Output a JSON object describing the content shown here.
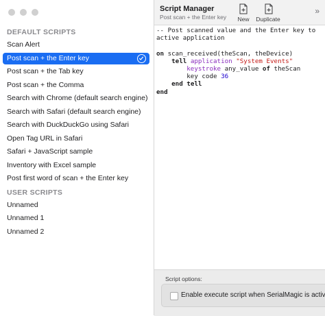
{
  "sidebar": {
    "default_header": "DEFAULT SCRIPTS",
    "user_header": "USER SCRIPTS",
    "default_items": [
      {
        "label": "Scan Alert"
      },
      {
        "label": "Post scan + the Enter key"
      },
      {
        "label": "Post scan + the Tab key"
      },
      {
        "label": "Post scan + the Comma"
      },
      {
        "label": "Search with Chrome (default search engine)"
      },
      {
        "label": "Search with Safari (default search engine)"
      },
      {
        "label": "Search with DuckDuckGo using Safari"
      },
      {
        "label": "Open Tag URL in Safari"
      },
      {
        "label": "Safari + JavaScript sample"
      },
      {
        "label": "Inventory with Excel sample"
      },
      {
        "label": "Post first word of scan + the Enter key"
      }
    ],
    "user_items": [
      {
        "label": "Unnamed"
      },
      {
        "label": "Unnamed 1"
      },
      {
        "label": "Unnamed 2"
      }
    ],
    "selected_index": 1
  },
  "toolbar": {
    "title": "Script Manager",
    "subtitle": "Post scan + the Enter key",
    "new_label": "New",
    "duplicate_label": "Duplicate",
    "more_icon": "chevron-double-right-icon"
  },
  "editor": {
    "line1": "-- Post scanned value and the Enter key to",
    "line2": "active application",
    "line3_kw": "on",
    "line3_rest": " scan_received(theScan, theDevice)",
    "line4_kw": "tell",
    "line4_app": "application",
    "line4_str": "\"System Events\"",
    "line5_cmd": "keystroke",
    "line5_var": " any_value ",
    "line5_of": "of",
    "line5_rest": " theScan",
    "line6_text": "key code ",
    "line6_num": "36",
    "line7_kw1": "end",
    "line7_kw2": "tell",
    "line8_kw": "end"
  },
  "options": {
    "label": "Script options:",
    "checkbox_text": "Enable execute script when SerialMagic is active",
    "checked": false
  },
  "colors": {
    "selection": "#1a6df2",
    "keyword_purple": "#8a2ebd",
    "string_red": "#c41a16",
    "number_blue": "#1c00cf"
  }
}
